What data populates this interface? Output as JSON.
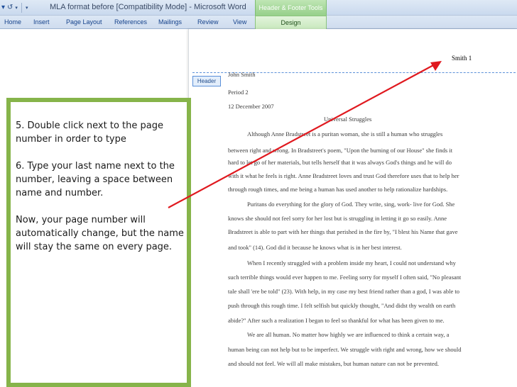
{
  "window": {
    "title": "MLA format before [Compatibility Mode] - Microsoft Word",
    "contextual_tab_group": "Header & Footer Tools"
  },
  "ribbon": {
    "tabs": [
      "Home",
      "Insert",
      "Page Layout",
      "References",
      "Mailings",
      "Review",
      "View"
    ],
    "contextual_tab": "Design"
  },
  "quick_access": {
    "icons": [
      "word-logo-icon",
      "undo-icon",
      "redo-icon",
      "customize-dropdown-icon"
    ]
  },
  "document": {
    "header_text": "Smith 1",
    "header_tag_label": "Header",
    "heading_lines": [
      "John Smith",
      "Period 2",
      "12 December 2007"
    ],
    "essay_title": "Universal Struggles",
    "paragraph_lines": [
      "Although Anne Bradstreet is a puritan woman, she is still a human who struggles",
      "between right and wrong. In Bradstreet's poem, \"Upon the burning of our House\" she finds it",
      "hard to let go of her materials, but tells herself that it was always God's things and he will do",
      "with it what he feels is right. Anne Bradstreet loves and trust God therefore uses that to help her",
      "through rough times, and me being a human has used another to help rationalize hardships.",
      "Puritans do everything for the glory of God. They write, sing, work- live for God. She",
      "knows she should not feel sorry for her lost but is struggling in letting it go so easily. Anne",
      "Bradstreet is able to part with her things that perished in the fire by, \"I blest his Name that gave",
      "and took\" (14). God did it because he knows what is in her best interest.",
      "When I recently struggled with a problem inside my heart, I could not understand why",
      "such terrible things would ever happen to me. Feeling sorry for myself I often said, \"No pleasant",
      "tale shall 'ere be told\" (23). With help, in my case my best friend rather than a god, I was able to",
      "push through this rough time. I felt selfish but quickly thought, \"And didst thy wealth on earth",
      "abide?\" After such a realization I began to feel so thankful for what has been given to me.",
      "We are all human. No matter how highly we are influenced to think a certain way, a",
      "human being can not help but to be imperfect. We struggle with right and wrong, how we should",
      "and should not feel. We will all make mistakes, but human nature can not be prevented."
    ]
  },
  "instructions": {
    "step5": "5. Double click next to the page number in order to type",
    "step6": "6. Type your last name next to the number, leaving a space between name and number.",
    "note": "Now, your page number will automatically  change, but the name will stay the same on every page."
  },
  "colors": {
    "instruction_border": "#86b44a",
    "arrow": "#e0191f",
    "header_boundary": "#5a8fd8",
    "context_tab": "#96d08a"
  }
}
